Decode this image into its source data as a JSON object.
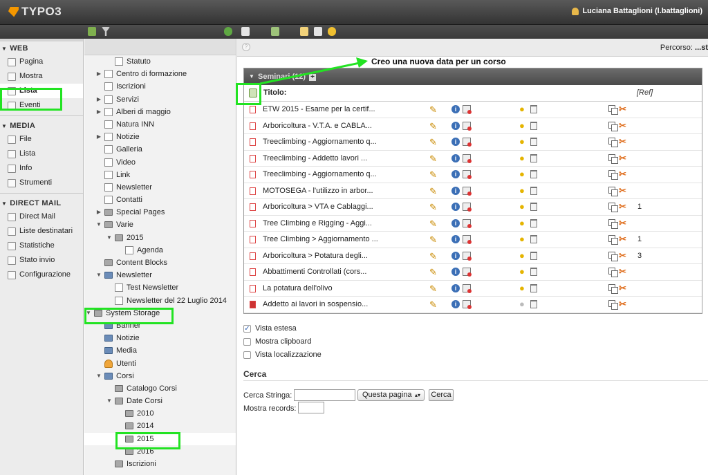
{
  "app": {
    "logo_text": "TYPO3",
    "user_label": "Luciana Battaglioni (l.battaglioni)"
  },
  "colors": {
    "accent_orange": "#f49700",
    "highlight_green": "#22e322",
    "panel_header": "#5a5a5a",
    "topbar": "#404040"
  },
  "modules": [
    {
      "group": "WEB",
      "items": [
        {
          "label": "Pagina",
          "icon": "page-edit-icon"
        },
        {
          "label": "Mostra",
          "icon": "view-icon"
        },
        {
          "label": "Lista",
          "icon": "list-icon",
          "active": true
        },
        {
          "label": "Eventi",
          "icon": "calendar-icon"
        }
      ]
    },
    {
      "group": "MEDIA",
      "items": [
        {
          "label": "File",
          "icon": "folder-icon"
        },
        {
          "label": "Lista",
          "icon": "file-list-icon"
        },
        {
          "label": "Info",
          "icon": "info-icon"
        },
        {
          "label": "Strumenti",
          "icon": "tools-icon"
        }
      ]
    },
    {
      "group": "DIRECT MAIL",
      "items": [
        {
          "label": "Direct Mail",
          "icon": "mail-icon"
        },
        {
          "label": "Liste destinatari",
          "icon": "recipients-icon"
        },
        {
          "label": "Statistiche",
          "icon": "stats-icon"
        },
        {
          "label": "Stato invio",
          "icon": "send-status-icon"
        },
        {
          "label": "Configurazione",
          "icon": "config-icon"
        }
      ]
    }
  ],
  "tree": [
    {
      "label": "Statuto",
      "level": 2,
      "type": "page"
    },
    {
      "label": "Centro di formazione",
      "level": 1,
      "type": "page",
      "toggle": "▶"
    },
    {
      "label": "Iscrizioni",
      "level": 1,
      "type": "page"
    },
    {
      "label": "Servizi",
      "level": 1,
      "type": "page",
      "toggle": "▶"
    },
    {
      "label": "Alberi di maggio",
      "level": 1,
      "type": "page",
      "toggle": "▶"
    },
    {
      "label": "Natura INN",
      "level": 1,
      "type": "page"
    },
    {
      "label": "Notizie",
      "level": 1,
      "type": "page",
      "toggle": "▶"
    },
    {
      "label": "Galleria",
      "level": 1,
      "type": "page"
    },
    {
      "label": "Video",
      "level": 1,
      "type": "page"
    },
    {
      "label": "Link",
      "level": 1,
      "type": "page"
    },
    {
      "label": "Newsletter",
      "level": 1,
      "type": "page"
    },
    {
      "label": "Contatti",
      "level": 1,
      "type": "page"
    },
    {
      "label": "Special Pages",
      "level": 1,
      "type": "folder",
      "toggle": "▶"
    },
    {
      "label": "Varie",
      "level": 1,
      "type": "folder",
      "toggle": "▼"
    },
    {
      "label": "2015",
      "level": 2,
      "type": "folder",
      "toggle": "▼"
    },
    {
      "label": "Agenda",
      "level": 3,
      "type": "page"
    },
    {
      "label": "Content Blocks",
      "level": 1,
      "type": "folder"
    },
    {
      "label": "Newsletter",
      "level": 1,
      "type": "sys",
      "toggle": "▼"
    },
    {
      "label": "Test Newsletter",
      "level": 2,
      "type": "page"
    },
    {
      "label": "Newsletter del 22 Luglio 2014",
      "level": 2,
      "type": "page"
    },
    {
      "label": "System Storage",
      "level": 0,
      "type": "folder",
      "toggle": "▼"
    },
    {
      "label": "Banner",
      "level": 1,
      "type": "sys"
    },
    {
      "label": "Notizie",
      "level": 1,
      "type": "sys"
    },
    {
      "label": "Media",
      "level": 1,
      "type": "sys"
    },
    {
      "label": "Utenti",
      "level": 1,
      "type": "usr"
    },
    {
      "label": "Corsi",
      "level": 1,
      "type": "sys",
      "toggle": "▼"
    },
    {
      "label": "Catalogo Corsi",
      "level": 2,
      "type": "folder"
    },
    {
      "label": "Date Corsi",
      "level": 2,
      "type": "folder",
      "toggle": "▼"
    },
    {
      "label": "2010",
      "level": 3,
      "type": "folder"
    },
    {
      "label": "2014",
      "level": 3,
      "type": "folder"
    },
    {
      "label": "2015",
      "level": 3,
      "type": "folder",
      "selected": true
    },
    {
      "label": "2016",
      "level": 3,
      "type": "folder"
    },
    {
      "label": "Iscrizioni",
      "level": 2,
      "type": "folder"
    }
  ],
  "main": {
    "path_label": "Percorso:",
    "path_value": "...st",
    "annotation": "Creo una nuova data per un corso",
    "table_title": "Seminari (12)",
    "col_title": "Titolo:",
    "col_ref": "[Ref]",
    "rows": [
      {
        "title": "ETW 2015 - Esame per la certif...",
        "ref": "",
        "hidden": false
      },
      {
        "title": "Arboricoltura - V.T.A. e CABLA...",
        "ref": "",
        "hidden": false
      },
      {
        "title": "Treeclimbing - Aggiornamento q...",
        "ref": "",
        "hidden": false
      },
      {
        "title": "Treeclimbing - Addetto lavori ...",
        "ref": "",
        "hidden": false
      },
      {
        "title": "Treeclimbing - Aggiornamento q...",
        "ref": "",
        "hidden": false
      },
      {
        "title": "MOTOSEGA - l'utilizzo in arbor...",
        "ref": "",
        "hidden": false
      },
      {
        "title": "Arboricoltura > VTA e Cablaggi...",
        "ref": "1",
        "hidden": false
      },
      {
        "title": "Tree Climbing e Rigging - Aggi...",
        "ref": "",
        "hidden": false
      },
      {
        "title": "Tree Climbing > Aggiornamento ...",
        "ref": "1",
        "hidden": false
      },
      {
        "title": "Arboricoltura > Potatura degli...",
        "ref": "3",
        "hidden": false
      },
      {
        "title": "Abbattimenti Controllati (cors...",
        "ref": "",
        "hidden": false
      },
      {
        "title": "La potatura dell'olivo",
        "ref": "",
        "hidden": false
      },
      {
        "title": "Addetto ai lavori in sospensio...",
        "ref": "",
        "hidden": true
      }
    ],
    "options": [
      {
        "label": "Vista estesa",
        "checked": true
      },
      {
        "label": "Mostra clipboard",
        "checked": false
      },
      {
        "label": "Vista localizzazione",
        "checked": false
      }
    ],
    "search": {
      "heading": "Cerca",
      "string_label": "Cerca Stringa:",
      "string_value": "",
      "scope_selected": "Questa pagina",
      "button": "Cerca",
      "records_label": "Mostra records:",
      "records_value": ""
    }
  }
}
